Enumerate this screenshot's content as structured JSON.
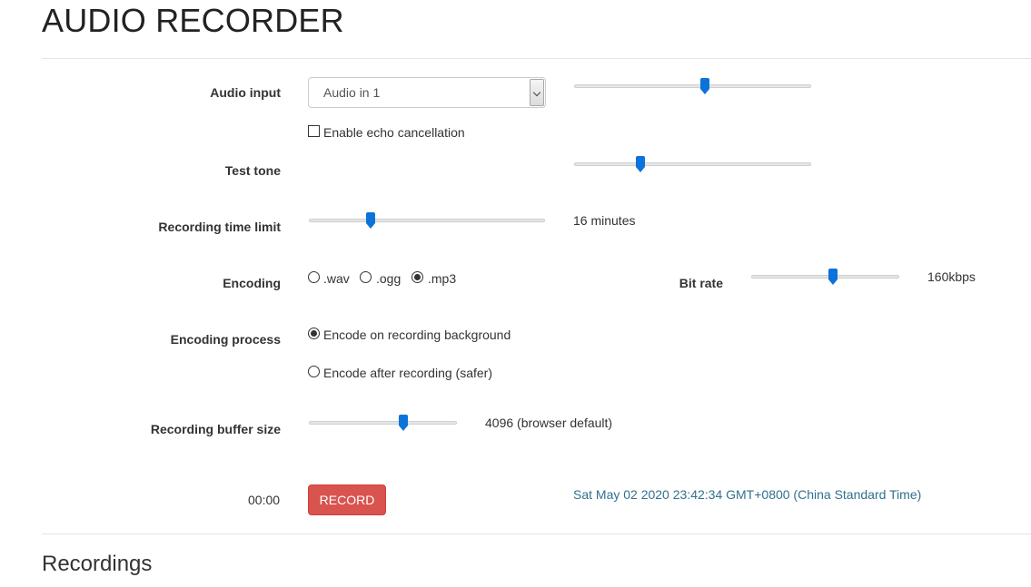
{
  "title": "AUDIO RECORDER",
  "audio_input": {
    "label": "Audio input",
    "selected": "Audio in 1",
    "volume_level": 0.55,
    "echo_label": "Enable echo cancellation",
    "echo_checked": false
  },
  "test_tone": {
    "label": "Test tone",
    "level": 0.28
  },
  "time_limit": {
    "label": "Recording time limit",
    "level": 0.26,
    "value_text": "16 minutes"
  },
  "encoding": {
    "label": "Encoding",
    "options": [
      {
        "label": ".wav",
        "checked": false
      },
      {
        "label": ".ogg",
        "checked": false
      },
      {
        "label": ".mp3",
        "checked": true
      }
    ],
    "bitrate_label": "Bit rate",
    "bitrate_level": 0.55,
    "bitrate_text": "160kbps"
  },
  "encoding_process": {
    "label": "Encoding process",
    "options": [
      {
        "label": "Encode on recording background",
        "checked": true
      },
      {
        "label": "Encode after recording (safer)",
        "checked": false
      }
    ]
  },
  "buffer": {
    "label": "Recording buffer size",
    "level": 0.64,
    "value_text": "4096 (browser default)"
  },
  "controls": {
    "timer": "00:00",
    "record_label": "RECORD",
    "date_text": "Sat May 02 2020 23:42:34 GMT+0800 (China Standard Time)"
  },
  "recordings": {
    "title": "Recordings"
  },
  "colors": {
    "accent": "#0b73d9",
    "record": "#d9534f",
    "date": "#31708f"
  }
}
